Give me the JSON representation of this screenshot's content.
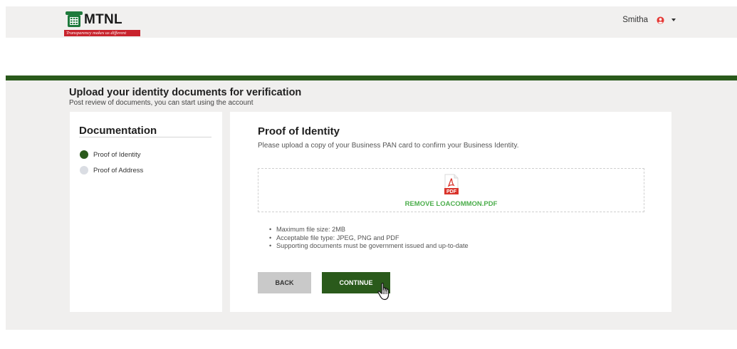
{
  "header": {
    "brand": "MTNL",
    "tagline": "Transparency makes us different",
    "user_name": "Smitha",
    "brand_colors": {
      "green": "#2a5a1b",
      "red": "#c8232c"
    }
  },
  "page": {
    "title": "Upload your identity documents for verification",
    "subtitle": "Post review of documents, you can start using the account"
  },
  "sidebar": {
    "title": "Documentation",
    "steps": [
      {
        "label": "Proof of Identity",
        "state": "active"
      },
      {
        "label": "Proof of Address",
        "state": "pending"
      }
    ]
  },
  "main": {
    "title": "Proof of Identity",
    "description": "Please upload a copy of your Business PAN card to confirm your Business Identity.",
    "file_icon_label": "PDF",
    "remove_link": "REMOVE LOACOMMON.PDF",
    "notes": [
      "Maximum file size: 2MB",
      "Acceptable file type: JPEG, PNG and PDF",
      "Supporting documents must be government issued and up-to-date"
    ],
    "back_label": "BACK",
    "continue_label": "CONTINUE"
  }
}
